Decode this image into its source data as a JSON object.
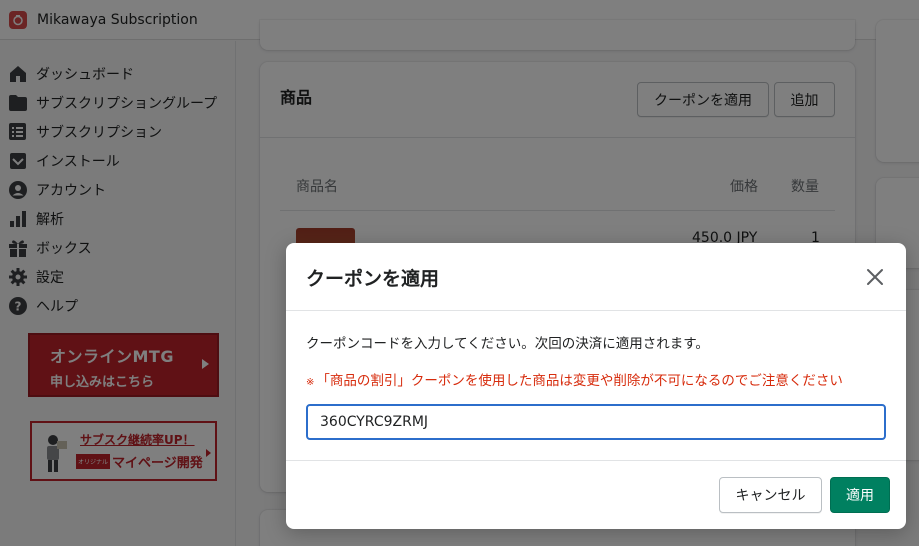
{
  "app": {
    "title": "Mikawaya Subscription",
    "logo_icon": "app-logo-icon"
  },
  "sidebar": {
    "items": [
      {
        "label": "ダッシュボード",
        "icon": "home-icon"
      },
      {
        "label": "サブスクリプショングループ",
        "icon": "folder-icon"
      },
      {
        "label": "サブスクリプション",
        "icon": "list-icon"
      },
      {
        "label": "インストール",
        "icon": "install-icon"
      },
      {
        "label": "アカウント",
        "icon": "user-icon"
      },
      {
        "label": "解析",
        "icon": "bar-chart-icon"
      },
      {
        "label": "ボックス",
        "icon": "gift-icon"
      },
      {
        "label": "設定",
        "icon": "gear-icon"
      },
      {
        "label": "ヘルプ",
        "icon": "help-icon"
      }
    ],
    "banner_online": {
      "title": "オンラインMTG",
      "subtitle": "申し込みはこちら"
    },
    "banner_mypage": {
      "title": "サブスク継続率UP！",
      "badge": "オリジナル",
      "subtitle": "マイページ開発"
    }
  },
  "products_card": {
    "title": "商品",
    "coupon_button": "クーポンを適用",
    "add_button": "追加",
    "columns": {
      "name": "商品名",
      "price": "価格",
      "qty": "数量"
    },
    "rows": [
      {
        "price": "450.0 JPY",
        "qty": "1"
      }
    ]
  },
  "modal": {
    "title": "クーポンを適用",
    "description": "クーポンコードを入力してください。次回の決済に適用されます。",
    "warning_mark": "※",
    "warning": "「商品の割引」クーポンを使用した商品は変更や削除が不可になるのでご注意ください",
    "coupon_value": "360CYRC9ZRMJ",
    "cancel_button": "キャンセル",
    "apply_button": "適用"
  },
  "colors": {
    "primary": "#008060",
    "warning": "#d72c0d",
    "focus": "#2c6ecb",
    "banner_red": "#c0232b"
  }
}
